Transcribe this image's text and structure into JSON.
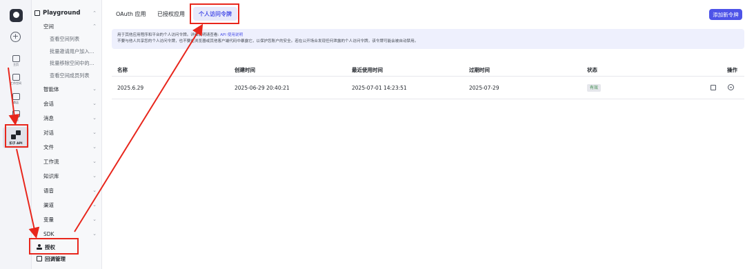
{
  "rail": {
    "items": [
      {
        "name": "home",
        "label": "主页"
      },
      {
        "name": "workspace",
        "label": "工作空间"
      },
      {
        "name": "store",
        "label": "商店"
      },
      {
        "name": "templates",
        "label": "模板"
      }
    ],
    "active_label": "扣子 API"
  },
  "sidebar": {
    "header": "Playground",
    "space": "空间",
    "space_items": [
      "查看空间列表",
      "批量邀请用户加入…",
      "批量移除空间中的…",
      "查看空间成员列表"
    ],
    "sections": [
      "智能体",
      "会话",
      "消息",
      "对话",
      "文件",
      "工作流",
      "知识库",
      "语音",
      "渠道",
      "变量",
      "SDK"
    ],
    "auth": "授权",
    "callback": "回调管理"
  },
  "tabs": [
    "OAuth 应用",
    "已授权应用",
    "个人访问令牌"
  ],
  "add_button": "添加新令牌",
  "notice": {
    "line1_prefix": "用于其他应用程序和平台的个人访问令牌。详细说明请查看:",
    "line1_link": "API 使用说明",
    "line2": "不要与他人共享您的个人访问令牌，也不要在浏览器或其他客户端代码中暴露它，以保护您账户的安全。若在公开场合发现任何泄露的个人访问令牌，该令牌可能会被自动禁用。"
  },
  "table": {
    "headers": [
      "名称",
      "创建时间",
      "最近使用时间",
      "过期时间",
      "状态",
      "操作"
    ],
    "rows": [
      {
        "name": "2025.6.29",
        "created": "2025-06-29 20:40:21",
        "last_used": "2025-07-01 14:23:51",
        "expires": "2025-07-29",
        "status": "有效"
      }
    ]
  },
  "colors": {
    "accent": "#4d53e8",
    "annotation": "#e8261c"
  }
}
